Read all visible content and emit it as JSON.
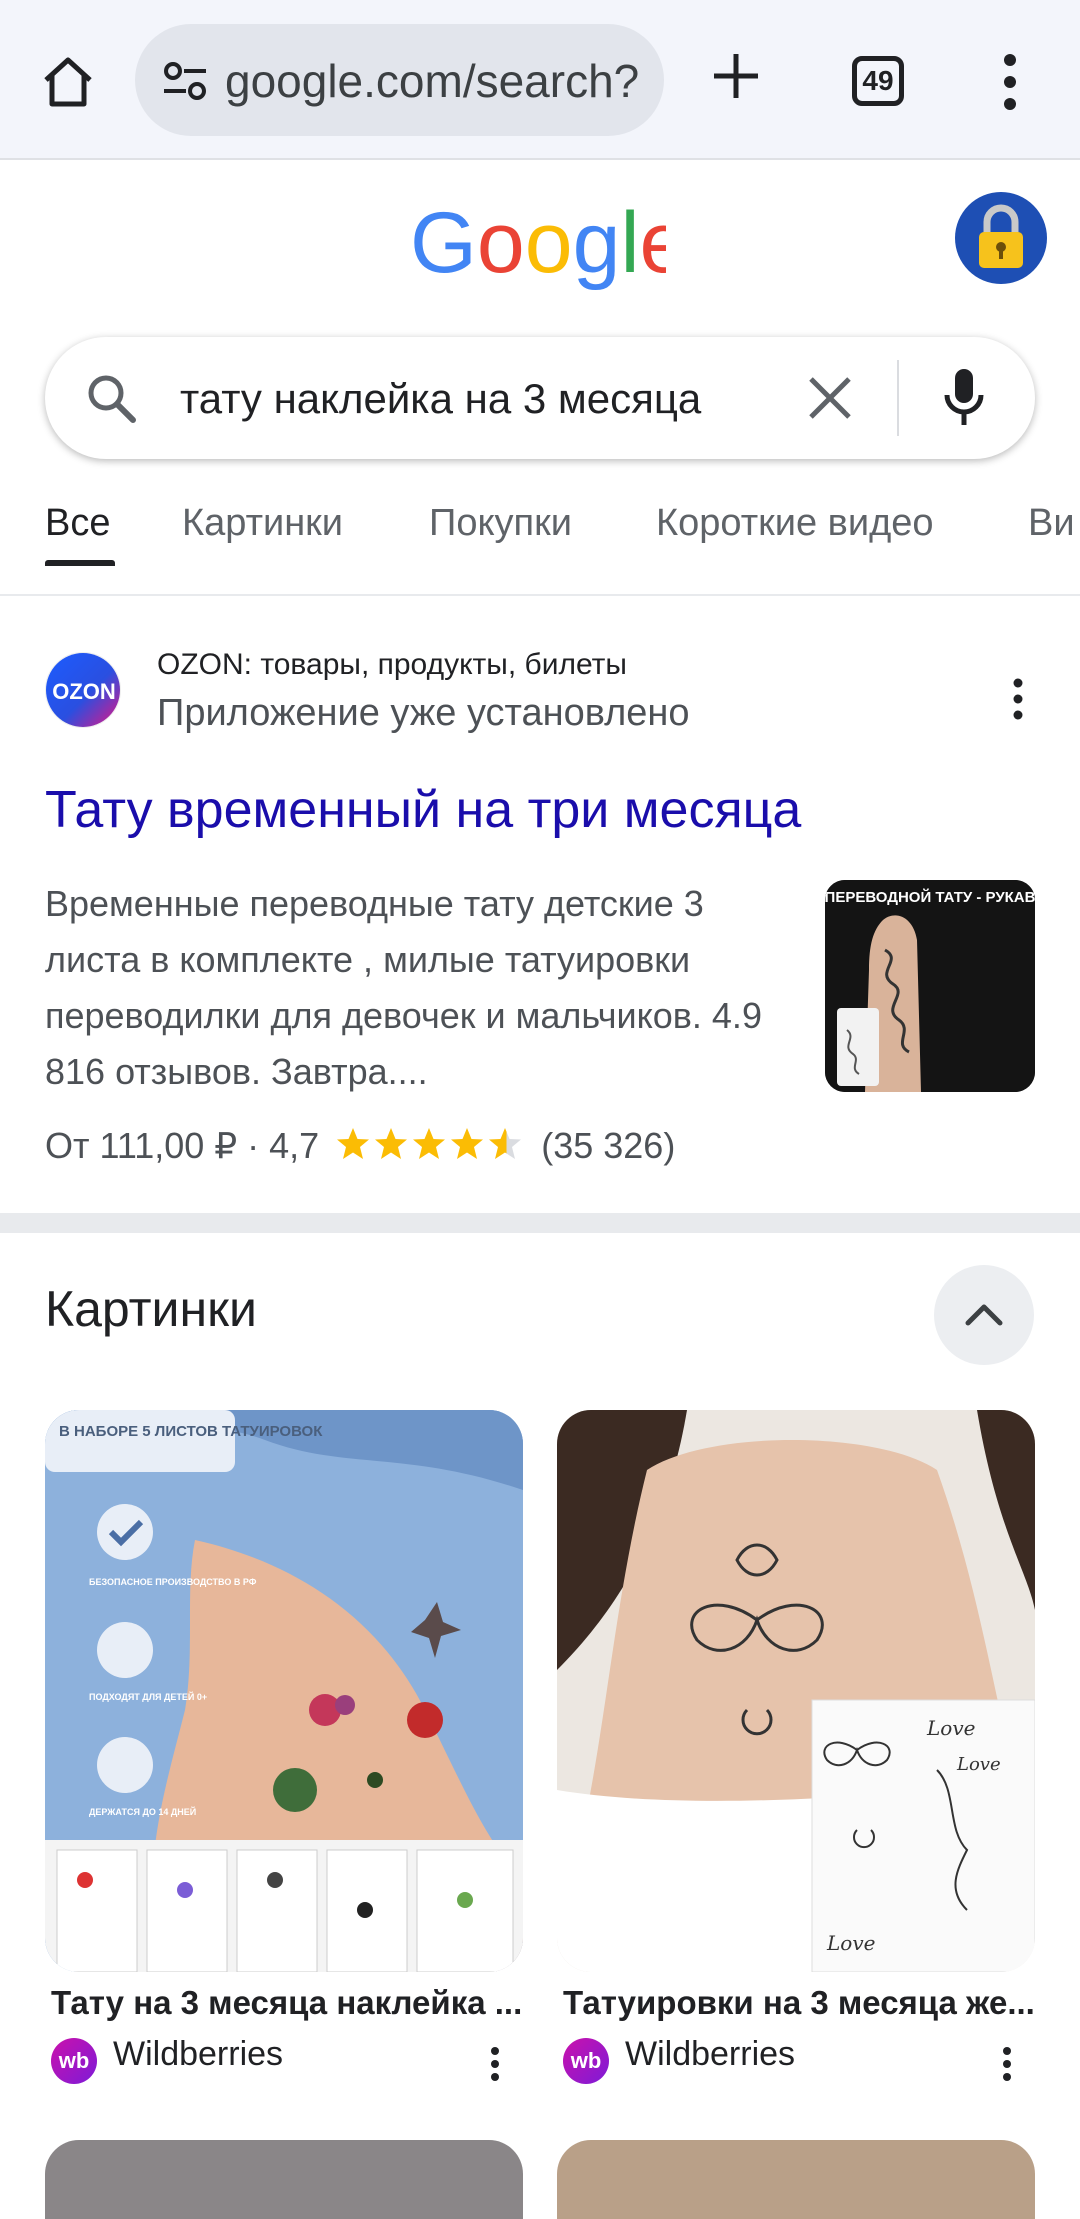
{
  "browser": {
    "url": "google.com/search?",
    "tab_count": "49"
  },
  "search": {
    "query": "тату наклейка на 3 месяца"
  },
  "filters": {
    "tabs": [
      "Все",
      "Картинки",
      "Покупки",
      "Короткие видео",
      "Ви"
    ]
  },
  "result": {
    "site_name": "OZON: товары, продукты, билеты",
    "app_status": "Приложение уже установлено",
    "logo_text": "OZON",
    "title": "Тату временный на три месяца",
    "snippet": "Временные переводные тату детские 3 листа в комплекте , милые татуировки переводилки для девочек и мальчиков. 4.9 816 отзывов. Завтра....",
    "price_prefix": "От 111,00 ₽ · 4,7",
    "rating": 4.7,
    "review_count": "(35 326)",
    "thumb_text": "ПЕРЕВОДНОЙ ТАТУ - РУКАВ"
  },
  "images": {
    "heading": "Картинки",
    "items": [
      {
        "caption": "Тату на 3 месяца наклейка ...",
        "source": "Wildberries",
        "source_logo": "wb",
        "overlay": "В НАБОРЕ 5 ЛИСТОВ ТАТУИРОВОК",
        "badges": [
          "БЕЗОПАСНОЕ ПРОИЗВОДСТВО В РФ",
          "ПОДХОДЯТ ДЛЯ ДЕТЕЙ 0+",
          "ДЕРЖАТСЯ ДО 14 ДНЕЙ"
        ]
      },
      {
        "caption": "Татуировки на 3 месяца же...",
        "source": "Wildberries",
        "source_logo": "wb",
        "sheet_words": [
          "Love",
          "Love",
          "Love"
        ]
      }
    ]
  },
  "colors": {
    "link": "#1a0dab",
    "star": "#fbbc04",
    "chrome_bg": "#f3f5fb"
  }
}
